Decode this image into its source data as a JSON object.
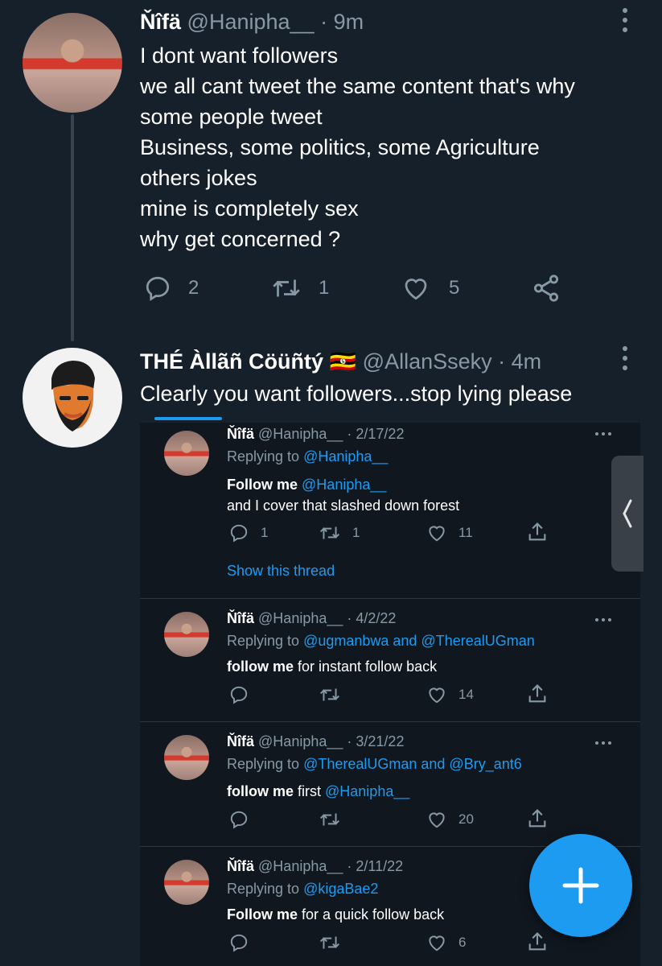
{
  "tweet1": {
    "name": "Ňîfä",
    "handle": "@Hanipha__",
    "time": "· 9m",
    "lines": [
      "I dont want followers",
      "we all cant tweet the same content that's why",
      "some people tweet",
      "Business, some politics, some Agriculture",
      "others jokes",
      "mine is completely sex",
      "why get concerned ?"
    ],
    "replies": "2",
    "retweets": "1",
    "likes": "5"
  },
  "tweet2": {
    "name": "THÉ Àllãñ Cöüñtý",
    "flag": "🇺🇬",
    "handle": "@AllanSseky",
    "time": "· 4m",
    "text": "Clearly you want followers...stop lying please"
  },
  "quoted": [
    {
      "name": "Ňîfä",
      "handle": "@Hanipha__",
      "time": "· 2/17/22",
      "replying_prefix": "Replying to",
      "replying_to": "@Hanipha__",
      "text_bold": "Follow me",
      "text_rest": "",
      "text_link": "@Hanipha__",
      "text_line2": "and I cover that slashed down forest",
      "replies": "1",
      "retweets": "1",
      "likes": "11",
      "show_thread": "Show this thread"
    },
    {
      "name": "Ňîfä",
      "handle": "@Hanipha__",
      "time": "· 4/2/22",
      "replying_prefix": "Replying to",
      "replying_to": "@ugmanbwa and @TherealUGman",
      "text_bold": "follow me",
      "text_rest": " for instant follow back",
      "likes": "14"
    },
    {
      "name": "Ňîfä",
      "handle": "@Hanipha__",
      "time": "· 3/21/22",
      "replying_prefix": "Replying to",
      "replying_to": "@TherealUGman and @Bry_ant6",
      "text_bold": "follow me",
      "text_rest": " first ",
      "text_link": "@Hanipha__",
      "likes": "20"
    },
    {
      "name": "Ňîfä",
      "handle": "@Hanipha__",
      "time": "· 2/11/22",
      "replying_prefix": "Replying to",
      "replying_to": "@kigaBae2",
      "text_bold": "Follow me",
      "text_rest": " for a quick follow back",
      "likes": "6"
    }
  ],
  "fab": {
    "icon": "plus-icon"
  },
  "colors": {
    "background": "#15202b",
    "accent": "#1d9bf0",
    "muted": "#8899a6"
  }
}
